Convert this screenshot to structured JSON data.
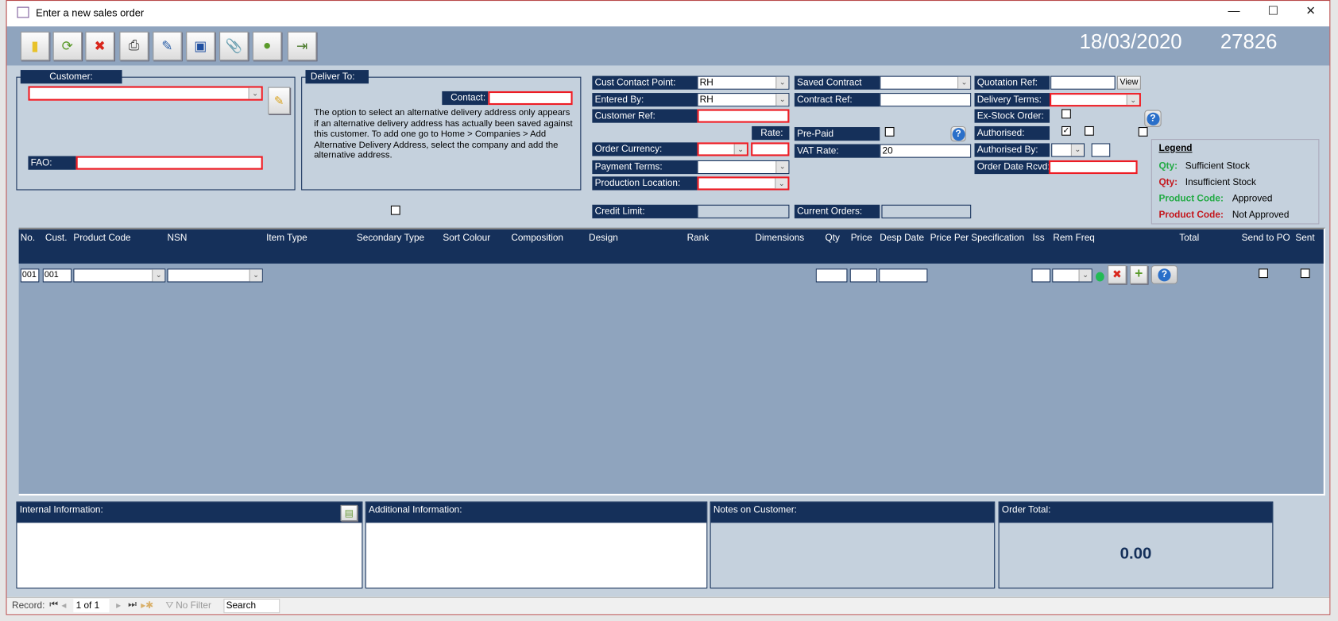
{
  "window": {
    "title": "Enter a new sales order",
    "controls": [
      "—",
      "☐",
      "✕"
    ]
  },
  "toolbar": {
    "buttons": [
      {
        "name": "new-note",
        "glyph": "▮",
        "color": "#e8c22a"
      },
      {
        "name": "refresh",
        "glyph": "⟳",
        "color": "#5a9a2a"
      },
      {
        "name": "delete",
        "glyph": "✖",
        "color": "#d9261c"
      },
      {
        "name": "print",
        "glyph": "⎙",
        "color": "#444"
      },
      {
        "name": "edit",
        "glyph": "✎",
        "color": "#2a5fa8"
      },
      {
        "name": "save",
        "glyph": "▣",
        "color": "#1f4fa0"
      },
      {
        "name": "attach",
        "glyph": "📎",
        "color": "#666"
      },
      {
        "name": "contact",
        "glyph": "●",
        "color": "#5a9a2a"
      },
      {
        "name": "export",
        "glyph": "⇥",
        "color": "#4a7a2a"
      }
    ],
    "date": "18/03/2020",
    "order_number": "27826"
  },
  "customer": {
    "title": "Customer:",
    "value": "",
    "fao_label": "FAO:",
    "fao_value": ""
  },
  "deliver": {
    "title": "Deliver To:",
    "contact_label": "Contact:",
    "contact_value": "",
    "note": "The option to select an alternative delivery address only appears if an alternative delivery address has actually been saved against this customer. To add one go to Home > Companies > Add Alternative Delivery Address, select the company and add the alternative address."
  },
  "fields": {
    "cust_contact_point": {
      "label": "Cust Contact Point:",
      "value": "RH"
    },
    "entered_by": {
      "label": "Entered By:",
      "value": "RH"
    },
    "customer_ref": {
      "label": "Customer Ref:",
      "value": ""
    },
    "rate": {
      "label": "Rate:",
      "value": ""
    },
    "order_currency": {
      "label": "Order Currency:",
      "value": ""
    },
    "payment_terms": {
      "label": "Payment Terms:",
      "value": ""
    },
    "production_location": {
      "label": "Production Location:",
      "value": ""
    },
    "credit_limit": {
      "label": "Credit Limit:",
      "value": ""
    },
    "saved_contract": {
      "label": "Saved Contract",
      "value": ""
    },
    "contract_ref": {
      "label": "Contract Ref:",
      "value": ""
    },
    "pre_paid": {
      "label": "Pre-Paid",
      "checked": false
    },
    "vat_rate": {
      "label": "VAT Rate:",
      "value": "20"
    },
    "current_orders": {
      "label": "Current Orders:",
      "value": ""
    },
    "quotation_ref": {
      "label": "Quotation Ref:",
      "value": "",
      "button": "View"
    },
    "delivery_terms": {
      "label": "Delivery Terms:",
      "value": ""
    },
    "ex_stock_order": {
      "label": "Ex-Stock Order:",
      "checked": false
    },
    "authorised": {
      "label": "Authorised:",
      "checked": true
    },
    "authorised_by": {
      "label": "Authorised By:",
      "value": ""
    },
    "order_date_rcvd": {
      "label": "Order Date Rcvd:",
      "value": ""
    }
  },
  "legend": {
    "title": "Legend",
    "items": [
      {
        "key": "Qty:",
        "text": "Sufficient Stock",
        "color": "#22aa44"
      },
      {
        "key": "Qty:",
        "text": "Insufficient Stock",
        "color": "#c4161c"
      },
      {
        "key": "Product Code:",
        "text": "Approved",
        "color": "#22aa44"
      },
      {
        "key": "Product Code:",
        "text": "Not Approved",
        "color": "#c4161c"
      }
    ]
  },
  "grid": {
    "columns": [
      "No.",
      "Cust.",
      "Product Code",
      "NSN",
      "Item Type",
      "Secondary Type",
      "Sort Colour",
      "Composition",
      "Design",
      "Rank",
      "Dimensions",
      "Qty",
      "Price",
      "Desp Date",
      "Price Per",
      "Specification",
      "Iss",
      "Rem Freq",
      "Total",
      "Send to PO",
      "Sent"
    ],
    "rows": [
      {
        "no": "001",
        "cust": "001"
      }
    ]
  },
  "panels": {
    "internal": "Internal Information:",
    "additional": "Additional Information:",
    "notes": "Notes on Customer:",
    "order_total_label": "Order Total:",
    "order_total": "0.00"
  },
  "status": {
    "record_label": "Record:",
    "position": "1 of 1",
    "filter": "No Filter",
    "search": "Search"
  }
}
